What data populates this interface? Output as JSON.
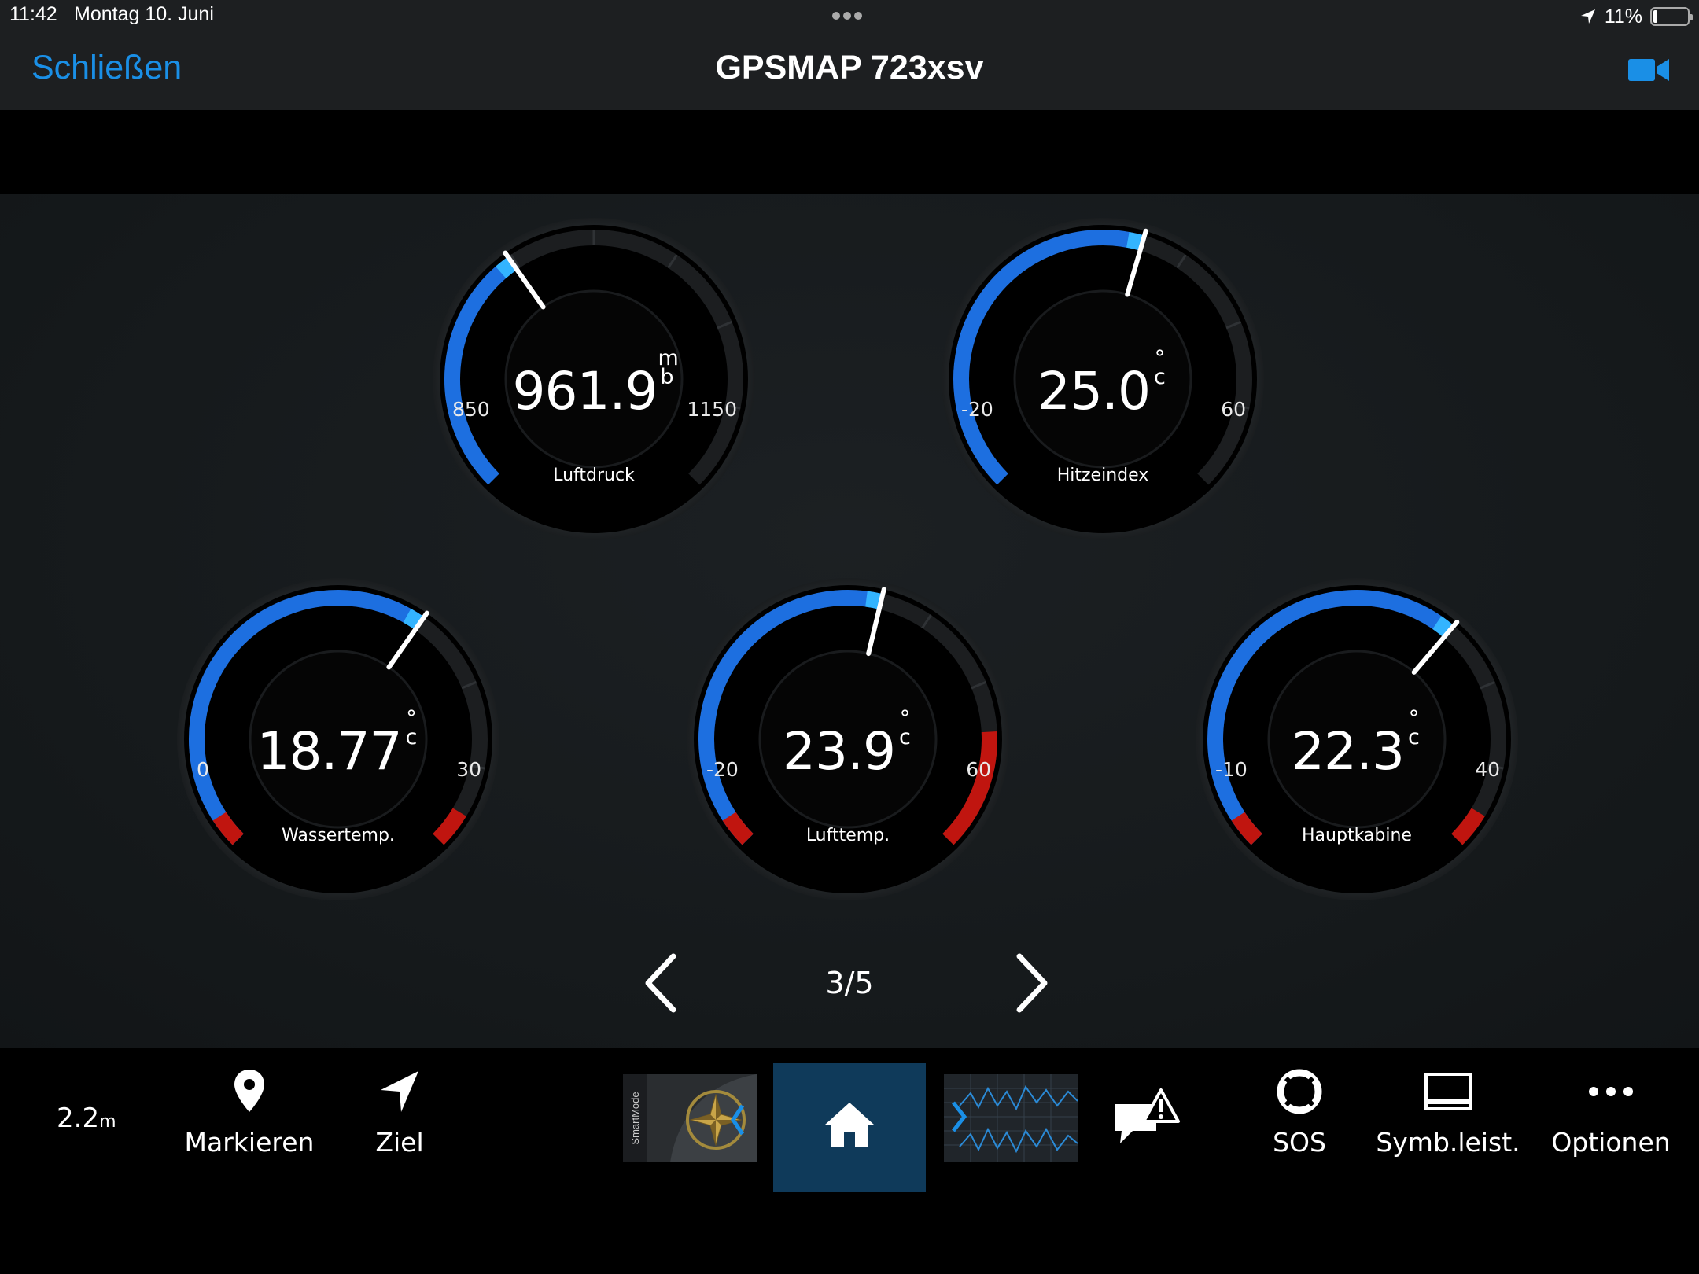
{
  "status_bar": {
    "time": "11:42",
    "date": "Montag 10. Juni",
    "battery_percent": "11%",
    "battery_level": 0.11
  },
  "nav": {
    "close_label": "Schließen",
    "title": "GPSMAP 723xsv",
    "accent_color": "#1a8fe6"
  },
  "gauges": [
    {
      "label": "Luftdruck",
      "value": "961.9",
      "unit_top": "m",
      "unit_bottom": "b",
      "min": "850",
      "max": "1150",
      "fraction": 0.37
    },
    {
      "label": "Hitzeindex",
      "value": "25.0",
      "unit_top": "°",
      "unit_bottom": "c",
      "min": "-20",
      "max": "60",
      "fraction": 0.56
    },
    {
      "label": "Wassertemp.",
      "value": "18.77",
      "unit_top": "°",
      "unit_bottom": "c",
      "min": "0",
      "max": "30",
      "fraction": 0.63
    },
    {
      "label": "Lufttemp.",
      "value": "23.9",
      "unit_top": "°",
      "unit_bottom": "c",
      "min": "-20",
      "max": "60",
      "fraction": 0.55
    },
    {
      "label": "Hauptkabine",
      "value": "22.3",
      "unit_top": "°",
      "unit_bottom": "c",
      "min": "-10",
      "max": "40",
      "fraction": 0.65
    }
  ],
  "pager": {
    "text": "3/5",
    "current": 3,
    "total": 5
  },
  "toolbar": {
    "depth_value": "2.2",
    "depth_unit": "m",
    "mark_label": "Markieren",
    "goto_label": "Ziel",
    "smartmode_text": "SmartMode",
    "sos_label": "SOS",
    "symbar_label": "Symb.leist.",
    "options_label": "Optionen"
  },
  "colors": {
    "gauge_blue": "#1d6fe0",
    "gauge_red": "#c0150f",
    "home_tile": "#0f3a5a"
  },
  "icons": [
    "location-arrow-icon",
    "battery-icon",
    "video-camera-icon",
    "chevron-left-icon",
    "chevron-right-icon",
    "map-pin-icon",
    "navigation-arrow-icon",
    "home-icon",
    "alert-message-icon",
    "lifebuoy-icon",
    "toolbar-icon",
    "more-icon"
  ]
}
